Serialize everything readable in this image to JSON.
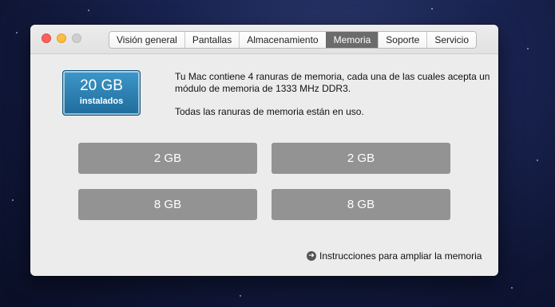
{
  "tabs": {
    "items": [
      {
        "label": "Visión general"
      },
      {
        "label": "Pantallas"
      },
      {
        "label": "Almacenamiento"
      },
      {
        "label": "Memoria"
      },
      {
        "label": "Soporte"
      },
      {
        "label": "Servicio"
      }
    ],
    "active": "Memoria"
  },
  "memory": {
    "total": "20 GB",
    "total_caption": "instalados",
    "description_line": "Tu Mac contiene 4 ranuras de memoria, cada una de las cuales acepta un módulo de memoria de 1333 MHz DDR3.",
    "status_line": "Todas las ranuras de memoria están en uso.",
    "slots": [
      {
        "size": "2 GB"
      },
      {
        "size": "2 GB"
      },
      {
        "size": "8 GB"
      },
      {
        "size": "8 GB"
      }
    ],
    "upgrade_link": "Instrucciones para ampliar la memoria",
    "upgrade_icon": "arrow-circle-icon"
  },
  "colors": {
    "badge": "#2a7fb3",
    "slot": "#939393",
    "active_tab": "#6b6b6b"
  }
}
